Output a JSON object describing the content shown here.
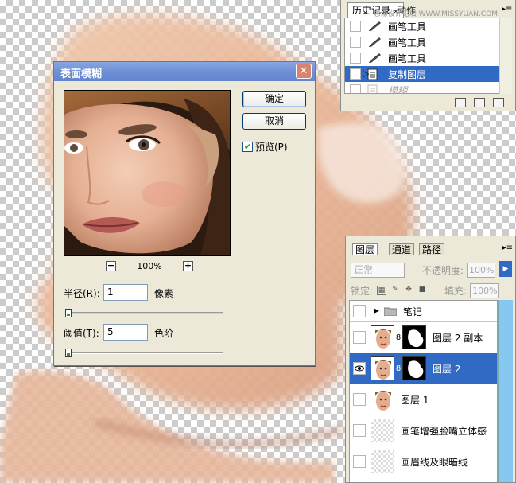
{
  "history_panel": {
    "tab_label": "历史记录",
    "second_tab_label": "动作",
    "watermark": "思缘设计论坛 WWW.MISSYUAN.COM",
    "items": [
      {
        "label": "画笔工具",
        "icon": "brush-icon",
        "state": "normal"
      },
      {
        "label": "画笔工具",
        "icon": "brush-icon",
        "state": "normal"
      },
      {
        "label": "画笔工具",
        "icon": "brush-icon",
        "state": "normal"
      },
      {
        "label": "复制图层",
        "icon": "document-icon",
        "state": "selected"
      },
      {
        "label": "模糊",
        "icon": "document-icon",
        "state": "dimmed"
      }
    ]
  },
  "dialog": {
    "title": "表面模糊",
    "ok_label": "确定",
    "cancel_label": "取消",
    "preview_label": "预览(P)",
    "preview_checked": true,
    "zoom_value": "100%",
    "zoom_out_label": "−",
    "zoom_in_label": "+",
    "radius_label": "半径(R):",
    "radius_value": "1",
    "radius_unit": "像素",
    "radius_slider_fraction": 0.0,
    "threshold_label": "阈值(T):",
    "threshold_value": "5",
    "threshold_unit": "色阶",
    "threshold_slider_fraction": 0.0
  },
  "layers_panel": {
    "tabs": [
      "图层",
      "通道",
      "路径"
    ],
    "blend_mode": "正常",
    "opacity_label": "不透明度:",
    "opacity_value": "100%",
    "lock_label": "锁定:",
    "fill_label": "填充:",
    "fill_value": "100%",
    "layers": [
      {
        "name": "笔记",
        "type": "group",
        "visible": false,
        "selected": false
      },
      {
        "name": "图层 2 副本",
        "type": "masked",
        "visible": false,
        "selected": false
      },
      {
        "name": "图层 2",
        "type": "masked",
        "visible": true,
        "selected": true
      },
      {
        "name": "图层 1",
        "type": "image",
        "visible": false,
        "selected": false
      },
      {
        "name": "画笔增强脸嘴立体感",
        "type": "empty",
        "visible": false,
        "selected": false
      },
      {
        "name": "画眉线及眼暗线",
        "type": "empty",
        "visible": false,
        "selected": false
      }
    ]
  },
  "colors": {
    "selection_blue": "#316ac5",
    "dialog_bg": "#ece9d8",
    "title_bar": "#6e8fd6",
    "skin_tone": "#e9b89a"
  }
}
